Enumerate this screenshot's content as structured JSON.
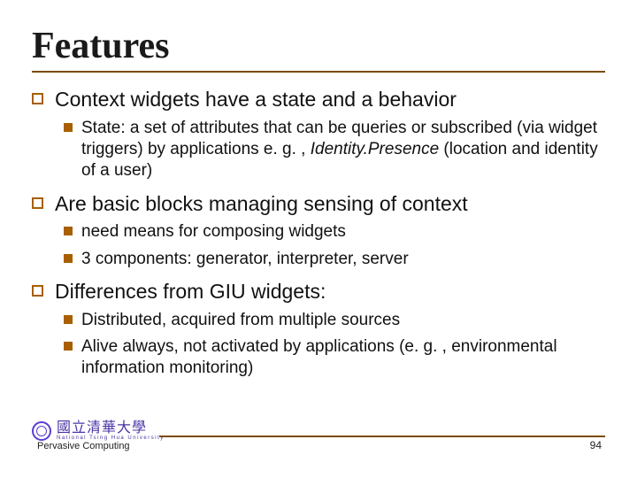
{
  "title": "Features",
  "items": [
    {
      "text": "Context widgets have a state and a behavior",
      "sub": [
        {
          "pre": "State: a set of attributes that can be queries or subscribed (via widget triggers) by applications e. g. , ",
          "italic": "Identity.Presence",
          "post": " (location and identity of a user)"
        }
      ]
    },
    {
      "text": "Are basic blocks managing sensing of context",
      "sub": [
        {
          "pre": "need means for composing widgets",
          "italic": "",
          "post": ""
        },
        {
          "pre": "3 components: generator, interpreter, server",
          "italic": "",
          "post": ""
        }
      ]
    },
    {
      "text": "Differences from GIU widgets:",
      "sub": [
        {
          "pre": "Distributed, acquired from multiple sources",
          "italic": "",
          "post": ""
        },
        {
          "pre": "Alive always, not activated by applications (e. g. , environmental information monitoring)",
          "italic": "",
          "post": ""
        }
      ]
    }
  ],
  "footer": {
    "university_cn": "國立清華大學",
    "university_en": "National Tsing Hua University",
    "course": "Pervasive Computing",
    "page": "94"
  }
}
